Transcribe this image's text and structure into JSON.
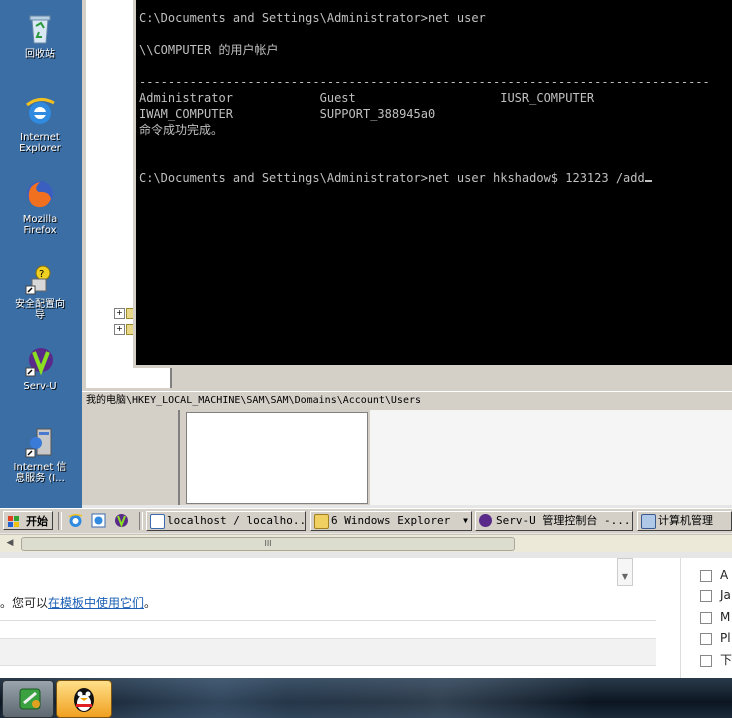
{
  "desktop": {
    "icons": [
      {
        "label": "回收站",
        "icon": "recycle-bin-icon"
      },
      {
        "label": "Internet\nExplorer",
        "icon": "internet-explorer-icon"
      },
      {
        "label": "Mozilla\nFirefox",
        "icon": "firefox-icon"
      },
      {
        "label": "安全配置向\n导",
        "icon": "security-wizard-icon"
      },
      {
        "label": "Serv-U",
        "icon": "serv-u-icon"
      },
      {
        "label": "Internet 信\n息服务 (I...",
        "icon": "iis-icon"
      }
    ]
  },
  "console": {
    "line1": "C:\\Documents and Settings\\Administrator>net user",
    "line2": "\\\\COMPUTER 的用户帐户",
    "separator": "-------------------------------------------------------------------------------",
    "users_row1": "Administrator            Guest                    IUSR_COMPUTER",
    "users_row2": "IWAM_COMPUTER            SUPPORT_388945a0",
    "success": "命令成功完成。",
    "prompt2": "C:\\Documents and Settings\\Administrator>net user hkshadow$ 123123 /add"
  },
  "regedit": {
    "status_path": "我的电脑\\HKEY_LOCAL_MACHINE\\SAM\\SAM\\Domains\\Account\\Users"
  },
  "taskbar": {
    "start_label": "开始",
    "buttons": [
      {
        "label": "localhost / localho...",
        "icon": "ie-page-icon"
      },
      {
        "label": "6 Windows Explorer",
        "icon": "folder-icon"
      },
      {
        "label": "Serv-U 管理控制台 -...",
        "icon": "serv-u-icon"
      },
      {
        "label": "计算机管理",
        "icon": "computer-management-icon"
      }
    ],
    "quicklaunch": [
      "ie-icon",
      "ie-alt-icon",
      "serv-u-icon"
    ]
  },
  "scrollbar": {
    "thumb_grip": "III"
  },
  "local_page": {
    "tip_prefix": "。您可以",
    "tip_link": "在模板中使用它们",
    "tip_suffix": "。",
    "checkbox_items": [
      "A",
      "Ja",
      "M",
      "Pl",
      "下"
    ]
  },
  "colors": {
    "desktop_bg": "#3a6ea5",
    "console_bg": "#000000",
    "console_fg": "#c0c0c0",
    "link": "#1a5fb4"
  }
}
